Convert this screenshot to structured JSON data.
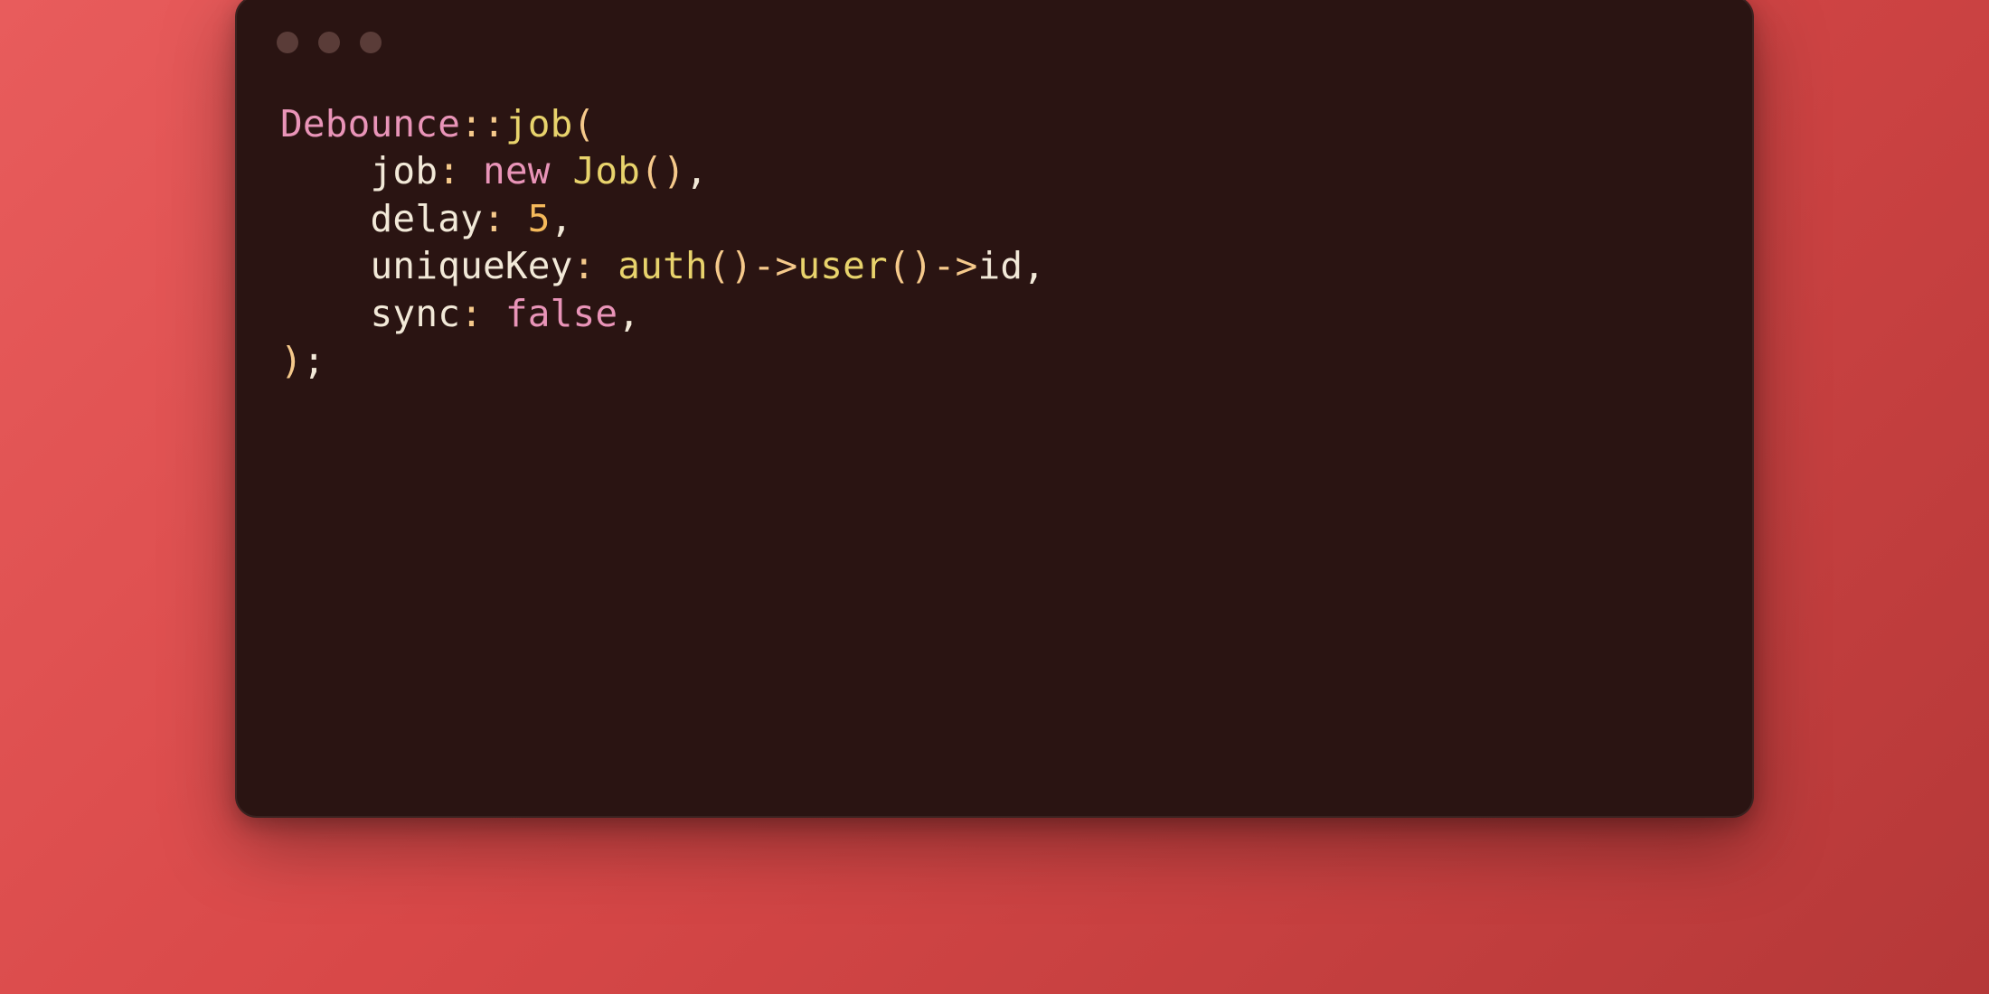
{
  "code": {
    "line1": {
      "class": "Debounce",
      "scope": "::",
      "method": "job",
      "open": "("
    },
    "line2": {
      "indent": "    ",
      "param": "job",
      "colon": ":",
      "space": " ",
      "kw": "new",
      "space2": " ",
      "type": "Job",
      "parens": "()",
      "comma": ","
    },
    "line3": {
      "indent": "    ",
      "param": "delay",
      "colon": ":",
      "space": " ",
      "num": "5",
      "comma": ","
    },
    "line4": {
      "indent": "    ",
      "param": "uniqueKey",
      "colon": ":",
      "space": " ",
      "fn1": "auth",
      "p1": "()",
      "arrow1": "->",
      "fn2": "user",
      "p2": "()",
      "arrow2": "->",
      "prop": "id",
      "comma": ","
    },
    "line5": {
      "indent": "    ",
      "param": "sync",
      "colon": ":",
      "space": " ",
      "kw": "false",
      "comma": ","
    },
    "line6": {
      "close": ")",
      "semi": ";"
    }
  }
}
